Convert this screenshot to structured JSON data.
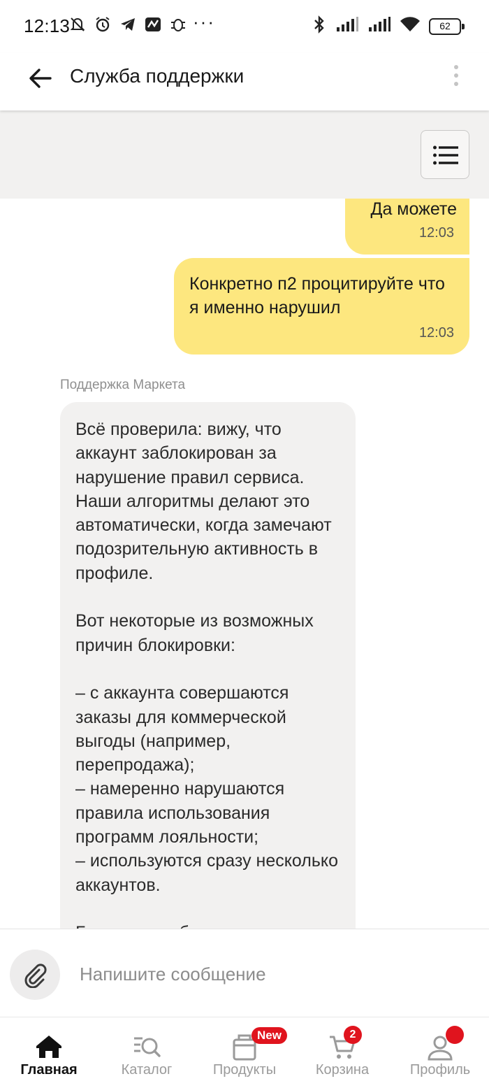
{
  "status_bar": {
    "time": "12:13",
    "battery": "62",
    "more_indicator": "···"
  },
  "header": {
    "title": "Служба поддержки"
  },
  "messages": {
    "outgoing": [
      {
        "text": "Да можете",
        "time": "12:03"
      },
      {
        "text": "Конкретно п2 процитируйте что я именно нарушил",
        "time": "12:03"
      }
    ],
    "incoming": {
      "sender": "Поддержка Маркета",
      "paragraphs": [
        "Всё проверила: вижу, что аккаунт заблокирован за нарушение правил сервиса. Наши алгоритмы делают это автоматически, когда замечают подозрительную активность в профиле.",
        "Вот некоторые из возможных причин блокировки:",
        "– с аккаунта совершаются заказы для коммерческой выгоды (например, перепродажа);\n– намеренно нарушаются правила использования программ лояльности;\n– используются сразу несколько аккаунтов.",
        "Более подробно пишем в"
      ]
    }
  },
  "composer": {
    "placeholder": "Напишите сообщение"
  },
  "bottom_nav": {
    "items": [
      {
        "label": "Главная",
        "icon": "home-icon",
        "active": true
      },
      {
        "label": "Каталог",
        "icon": "catalog-search-icon"
      },
      {
        "label": "Продукты",
        "icon": "grocery-bag-icon",
        "badge": "New"
      },
      {
        "label": "Корзина",
        "icon": "cart-icon",
        "badge": "2"
      },
      {
        "label": "Профиль",
        "icon": "profile-icon"
      }
    ]
  },
  "colors": {
    "outgoing_bubble": "#fde77f",
    "incoming_bubble": "#f2f1f0",
    "badge": "#e0141e"
  }
}
